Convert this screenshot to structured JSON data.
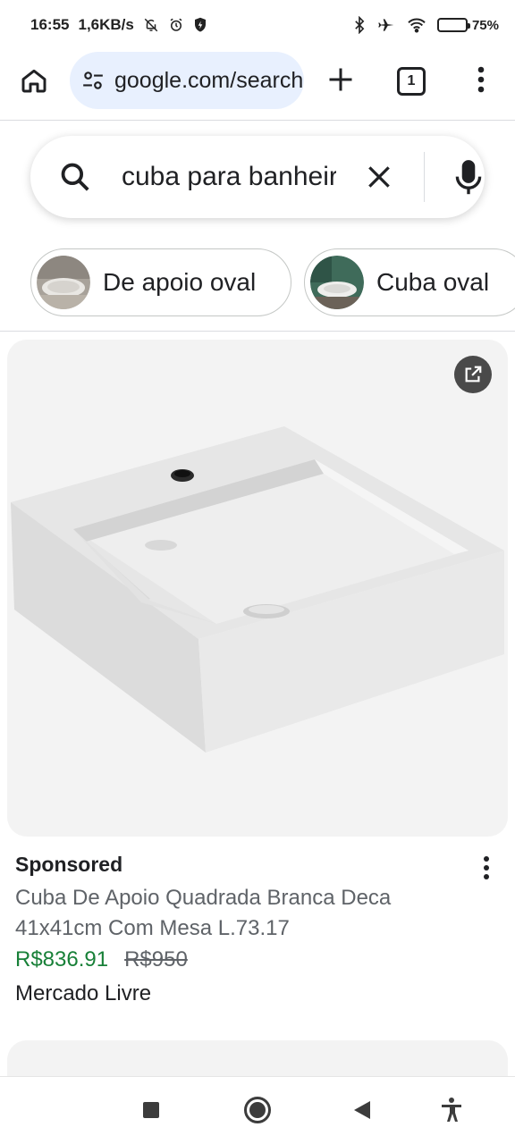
{
  "status_bar": {
    "time": "16:55",
    "speed": "1,6KB/s",
    "battery": "75",
    "battery_level_percent": 75,
    "icons": [
      "notifications-off-icon",
      "alarm-icon",
      "shield-icon",
      "bluetooth-icon",
      "airplane-icon",
      "wifi-icon",
      "battery-icon"
    ]
  },
  "toolbar": {
    "url": "google.com/search",
    "tab_count": "1",
    "icons": [
      "home-icon",
      "tune-icon",
      "plus-icon",
      "tabs-icon",
      "more-vert-icon"
    ]
  },
  "search": {
    "query": "cuba para banheiro",
    "icons": [
      "search-icon",
      "close-icon",
      "mic-icon"
    ]
  },
  "chips": [
    {
      "label": "De apoio oval"
    },
    {
      "label": "Cuba oval"
    }
  ],
  "product": {
    "sponsored_label": "Sponsored",
    "title": "Cuba De Apoio Quadrada Branca Deca 41x41cm Com Mesa L.73.17",
    "price": "R$836.91",
    "old_price": "R$950",
    "merchant": "Mercado Livre",
    "icons": [
      "open-in-new-icon",
      "more-vert-icon"
    ]
  },
  "nav_bar": {
    "icons": [
      "recents-icon",
      "home-circle-icon",
      "back-icon",
      "accessibility-icon"
    ]
  },
  "colors": {
    "url_pill_bg": "#e8f0fe",
    "price_green": "#188038",
    "card_bg": "#f3f3f3"
  }
}
